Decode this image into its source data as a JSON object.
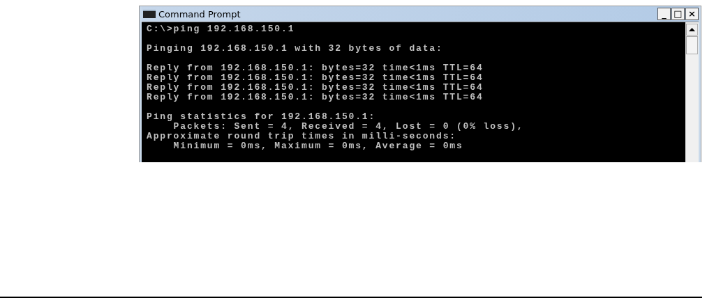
{
  "window": {
    "title": "Command Prompt",
    "controls": [
      "_",
      "□",
      "×"
    ]
  },
  "console": {
    "blocks": [
      [
        "C:\\>ping 192.168.150.1"
      ],
      [
        "Pinging 192.168.150.1 with 32 bytes of data:"
      ],
      [
        "Reply from 192.168.150.1: bytes=32 time<1ms TTL=64",
        "Reply from 192.168.150.1: bytes=32 time<1ms TTL=64",
        "Reply from 192.168.150.1: bytes=32 time<1ms TTL=64",
        "Reply from 192.168.150.1: bytes=32 time<1ms TTL=64"
      ],
      [
        "Ping statistics for 192.168.150.1:",
        "    Packets: Sent = 4, Received = 4, Lost = 0 (0% loss),",
        "Approximate round trip times in milli-seconds:",
        "    Minimum = 0ms, Maximum = 0ms, Average = 0ms"
      ]
    ]
  }
}
